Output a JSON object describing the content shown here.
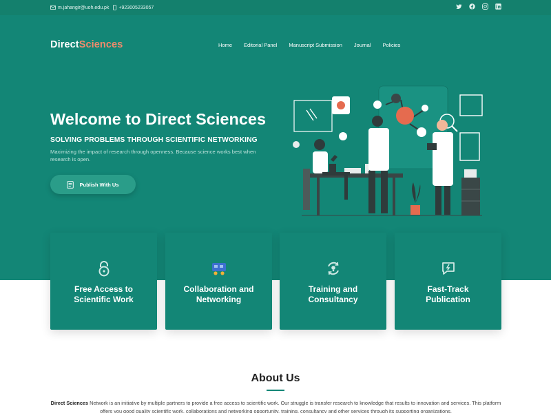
{
  "topbar": {
    "email": "m.jahangir@uoh.edu.pk",
    "phone": "+923005233057",
    "icons": [
      "mail-icon",
      "phone-icon",
      "twitter-icon",
      "facebook-icon",
      "instagram-icon",
      "linkedin-icon"
    ]
  },
  "brand": {
    "part1": "Direct",
    "part2": "Sciences"
  },
  "nav": {
    "items": [
      "Home",
      "Editorial Panel",
      "Manuscript Submission",
      "Journal",
      "Policies"
    ]
  },
  "hero": {
    "title": "Welcome to Direct Sciences",
    "subtitle": "SOLVING PROBLEMS THROUGH SCIENTIFIC NETWORKING",
    "description": "Maximizing the impact of research through openness. Because science works best when research is open.",
    "cta": "Publish With Us"
  },
  "features": [
    {
      "line1": "Free Access to",
      "line2": "Scientific Work",
      "icon": "lock-icon"
    },
    {
      "line1": "Collaboration and",
      "line2": "Networking",
      "icon": "network-icon"
    },
    {
      "line1": "Training and",
      "line2": "Consultancy",
      "icon": "training-icon"
    },
    {
      "line1": "Fast-Track",
      "line2": "Publication",
      "icon": "fast-track-icon"
    }
  ],
  "about": {
    "title": "About Us",
    "brand": "Direct Sciences",
    "text": "Network is an initiative by multiple partners to provide a free access to scientific work. Our struggle is transfer research to knowledge that results to innovation and services. This platform offers you good quality scientific work, collaborations and networking opportunity, training, consultancy and other services through its supporting organizations."
  },
  "colors": {
    "primary": "#138676",
    "accent": "#f08b6c",
    "text": "#222222"
  }
}
